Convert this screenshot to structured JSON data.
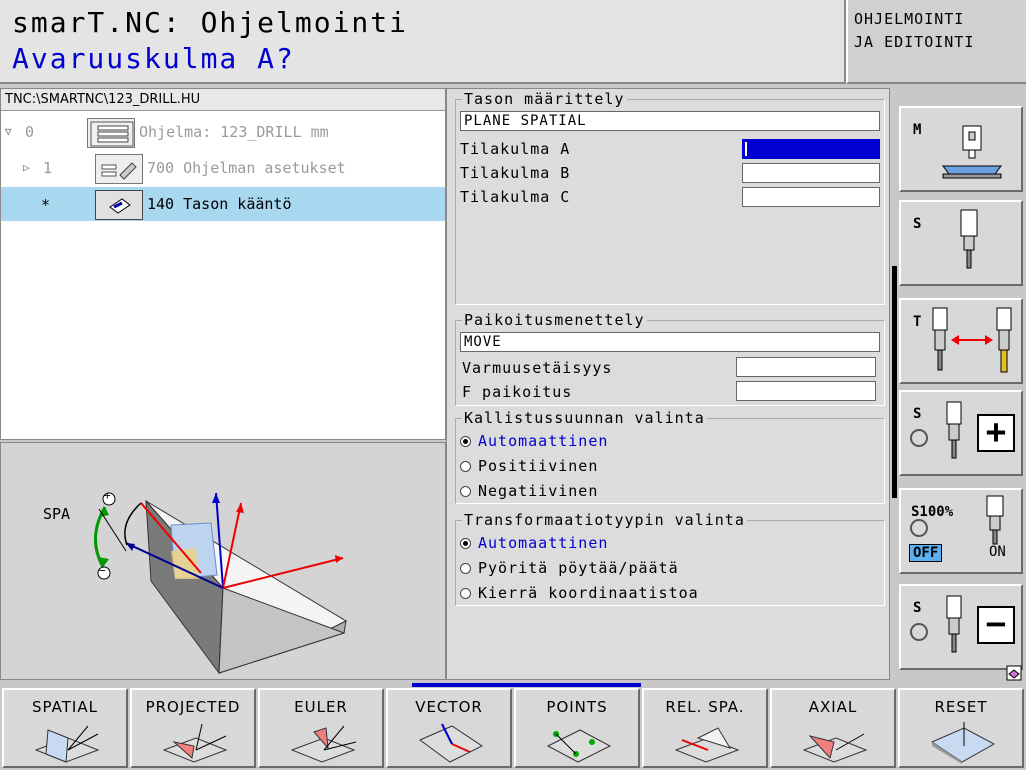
{
  "header": {
    "title": "smarT.NC: Ohjelmointi",
    "prompt": "Avaruuskulma A?",
    "mode_line1": "OHJELMOINTI",
    "mode_line2": "JA EDITOINTI"
  },
  "tree": {
    "path": "TNC:\\SMARTNC\\123_DRILL.HU",
    "rows": [
      {
        "arrow": "▽",
        "num": "0",
        "label": "Ohjelma: 123_DRILL mm"
      },
      {
        "arrow": "▷",
        "num": "1",
        "label": "700 Ohjelman asetukset"
      },
      {
        "arrow": "",
        "num": "*",
        "label": "140 Tason kääntö"
      }
    ]
  },
  "help": {
    "spa_label": "SPA",
    "plus": "+",
    "minus": "−"
  },
  "form": {
    "plane_group": {
      "title": "Tason määrittely",
      "value": "PLANE SPATIAL",
      "fields": [
        {
          "label": "Tilakulma A",
          "value": "",
          "active": true
        },
        {
          "label": "Tilakulma B",
          "value": ""
        },
        {
          "label": "Tilakulma C",
          "value": ""
        }
      ]
    },
    "position_group": {
      "title": "Paikoitusmenettely",
      "value": "MOVE",
      "fields": [
        {
          "label": "Varmuusetäisyys",
          "value": ""
        },
        {
          "label": "F paikoitus",
          "value": ""
        }
      ]
    },
    "tilt_group": {
      "title": "Kallistussuunnan valinta",
      "options": [
        "Automaattinen",
        "Positiivinen",
        "Negatiivinen"
      ],
      "selected": "Automaattinen"
    },
    "transform_group": {
      "title": "Transformaatiotyypin valinta",
      "options": [
        "Automaattinen",
        "Pyöritä pöytää/päätä",
        "Kierrä koordinaatistoa"
      ],
      "selected": "Automaattinen"
    }
  },
  "sidebar": {
    "keys": [
      {
        "label": "M",
        "icon": "machine-icon"
      },
      {
        "label": "S",
        "icon": "spindle-icon"
      },
      {
        "label": "T",
        "icon": "tool-change-icon"
      },
      {
        "label": "S",
        "icon": "spindle-plus-icon",
        "symbol": "+"
      },
      {
        "label": "S100%",
        "icon": "spindle-override-icon",
        "off": "OFF",
        "on": "ON"
      },
      {
        "label": "S",
        "icon": "spindle-minus-icon",
        "symbol": "−"
      }
    ]
  },
  "softkeys": [
    "SPATIAL",
    "PROJECTED",
    "EULER",
    "VECTOR",
    "POINTS",
    "REL. SPA.",
    "AXIAL",
    "RESET"
  ],
  "colors": {
    "prompt": "#0000d0",
    "selection": "#a8d8f0",
    "active_field": "#0000d0",
    "red_axis": "#e00000",
    "blue_axis": "#000090"
  }
}
